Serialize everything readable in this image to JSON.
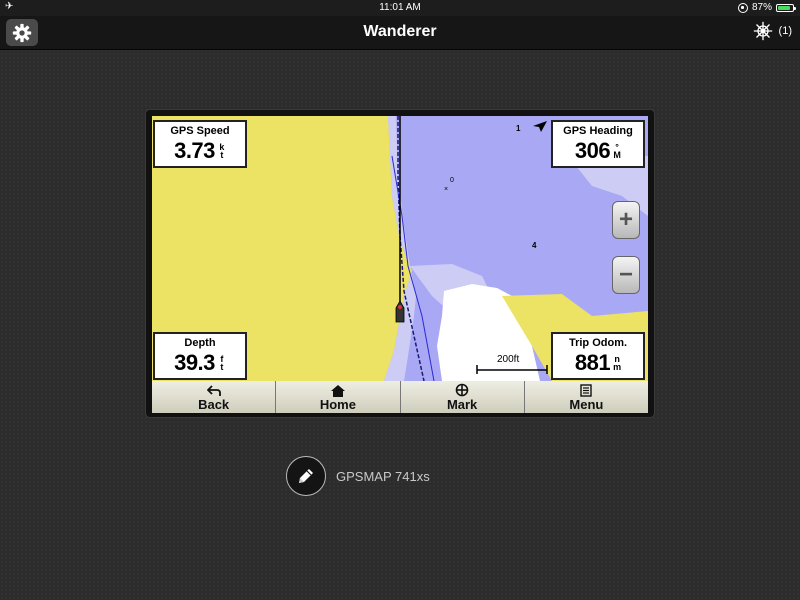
{
  "status_bar": {
    "time": "11:01 AM",
    "battery_percent": "87%",
    "battery_level": 0.87
  },
  "nav": {
    "title": "Wanderer",
    "helm_count": "(1)"
  },
  "chart": {
    "depth_soundings": [
      "1",
      "0",
      "4"
    ],
    "scale_label": "200ft"
  },
  "data_fields": {
    "gps_speed": {
      "label": "GPS Speed",
      "value": "3.73",
      "unit_top": "k",
      "unit_bottom": "t"
    },
    "gps_heading": {
      "label": "GPS Heading",
      "value": "306",
      "unit_top": "°",
      "unit_bottom": "M"
    },
    "depth": {
      "label": "Depth",
      "value": "39.3",
      "unit_top": "f",
      "unit_bottom": "t"
    },
    "trip_odom": {
      "label": "Trip Odom.",
      "value": "881",
      "unit_top": "n",
      "unit_bottom": "m"
    }
  },
  "zoom": {
    "plus": "+",
    "minus": "−"
  },
  "softkeys": {
    "back": "Back",
    "home": "Home",
    "mark": "Mark",
    "menu": "Menu"
  },
  "device": {
    "name": "GPSMAP 741xs"
  },
  "icons": {
    "settings": "gear-icon",
    "helm": "ship-wheel-icon",
    "airplane": "airplane-icon",
    "edit": "pencil-icon",
    "back": "back-arrow-icon",
    "home": "home-icon",
    "mark": "crosshair-icon",
    "menu": "menu-icon"
  },
  "colors": {
    "land": "#ece263",
    "water": "#a9a8f4",
    "shallow": "#cdccf5",
    "nav_bg": "#161616"
  }
}
